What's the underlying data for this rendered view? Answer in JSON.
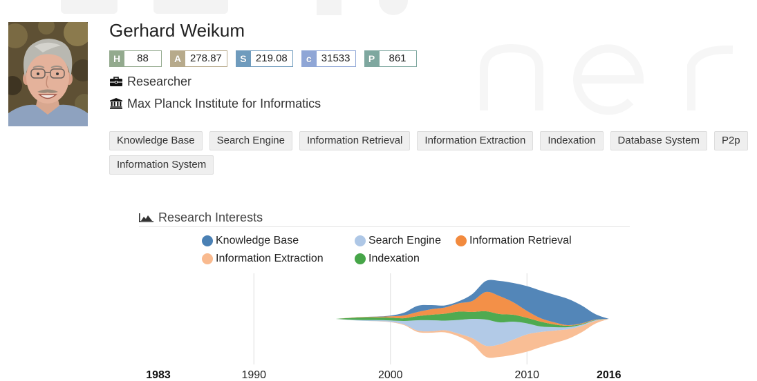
{
  "profile": {
    "name": "Gerhard Weikum",
    "metrics": [
      {
        "letter": "H",
        "value": "88",
        "color": "#93aa8e"
      },
      {
        "letter": "A",
        "value": "278.87",
        "color": "#b7aa8b"
      },
      {
        "letter": "S",
        "value": "219.08",
        "color": "#6f9bbd"
      },
      {
        "letter": "c",
        "value": "31533",
        "color": "#8fa6d6"
      },
      {
        "letter": "P",
        "value": "861",
        "color": "#7ea79f"
      }
    ],
    "position": {
      "icon": "briefcase-icon",
      "text": "Researcher"
    },
    "affiliation": {
      "icon": "institution-icon",
      "text": "Max Planck Institute for Informatics"
    },
    "tags": [
      "Knowledge Base",
      "Search Engine",
      "Information Retrieval",
      "Information Extraction",
      "Indexation",
      "Database System",
      "P2p",
      "Information System"
    ]
  },
  "interests": {
    "icon": "area-chart-icon"
  },
  "chart_data": {
    "type": "area",
    "stacked": true,
    "style": "streamgraph",
    "title": "Research Interests",
    "xlim": [
      1983,
      2016
    ],
    "x_ticks": [
      1983,
      1990,
      2000,
      2010,
      2016
    ],
    "grid": "vertical",
    "legend_position": "top",
    "x": [
      1996,
      1997,
      1998,
      1999,
      2000,
      2001,
      2002,
      2003,
      2004,
      2005,
      2006,
      2007,
      2008,
      2009,
      2010,
      2011,
      2012,
      2013,
      2014,
      2015,
      2016
    ],
    "series": [
      {
        "name": "Knowledge Base",
        "color": "#4a80b4",
        "values": [
          0,
          0,
          0,
          0.3,
          1,
          4,
          9,
          6,
          3,
          3,
          10,
          16,
          22,
          28,
          36,
          40,
          40,
          38,
          26,
          8,
          0
        ]
      },
      {
        "name": "Search Engine",
        "color": "#aec7e6",
        "values": [
          0,
          0.5,
          1,
          1.5,
          2,
          5,
          15,
          16,
          14,
          20,
          28,
          38,
          32,
          26,
          16,
          8,
          5,
          3,
          2,
          1,
          0
        ]
      },
      {
        "name": "Information Retrieval",
        "color": "#f28a3e",
        "values": [
          0,
          0.3,
          0.5,
          1,
          2,
          4,
          6,
          8,
          9,
          12,
          16,
          28,
          26,
          18,
          10,
          5,
          3,
          1,
          1,
          0.5,
          0
        ]
      },
      {
        "name": "Information Extraction",
        "color": "#f9ba8f",
        "values": [
          0,
          0,
          0,
          0.2,
          0.5,
          1,
          2,
          2,
          3,
          4,
          8,
          16,
          18,
          22,
          25,
          22,
          18,
          14,
          9,
          4,
          0
        ]
      },
      {
        "name": "Indexation",
        "color": "#46a548",
        "values": [
          0,
          2.5,
          4,
          4,
          4,
          4,
          6,
          8,
          10,
          12,
          10,
          12,
          12,
          10,
          8,
          7,
          4,
          2,
          1,
          0.5,
          0
        ]
      }
    ]
  }
}
